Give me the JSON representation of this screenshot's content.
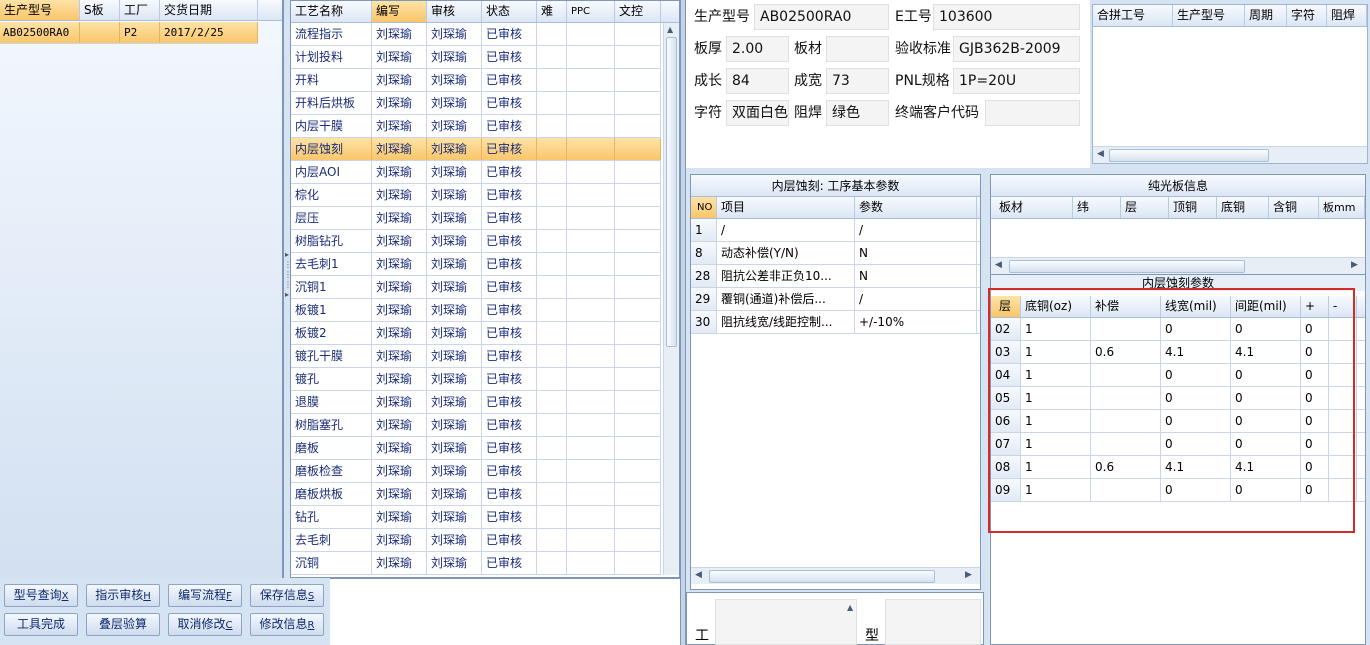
{
  "product_list": {
    "columns": [
      "生产型号",
      "S板",
      "工厂",
      "交货日期"
    ],
    "rows": [
      [
        "AB02500RA0",
        "",
        "P2",
        "2017/2/25"
      ]
    ]
  },
  "process_list": {
    "columns": [
      "工艺名称",
      "编写",
      "审核",
      "状态",
      "难",
      "PPC",
      "文控"
    ],
    "rows": [
      [
        "流程指示",
        "刘琛瑜",
        "刘琛瑜",
        "已审核"
      ],
      [
        "计划投料",
        "刘琛瑜",
        "刘琛瑜",
        "已审核"
      ],
      [
        "开料",
        "刘琛瑜",
        "刘琛瑜",
        "已审核"
      ],
      [
        "开料后烘板",
        "刘琛瑜",
        "刘琛瑜",
        "已审核"
      ],
      [
        "内层干膜",
        "刘琛瑜",
        "刘琛瑜",
        "已审核"
      ],
      [
        "内层蚀刻",
        "刘琛瑜",
        "刘琛瑜",
        "已审核"
      ],
      [
        "内层AOI",
        "刘琛瑜",
        "刘琛瑜",
        "已审核"
      ],
      [
        "棕化",
        "刘琛瑜",
        "刘琛瑜",
        "已审核"
      ],
      [
        "层压",
        "刘琛瑜",
        "刘琛瑜",
        "已审核"
      ],
      [
        "树脂钻孔",
        "刘琛瑜",
        "刘琛瑜",
        "已审核"
      ],
      [
        "去毛刺1",
        "刘琛瑜",
        "刘琛瑜",
        "已审核"
      ],
      [
        "沉铜1",
        "刘琛瑜",
        "刘琛瑜",
        "已审核"
      ],
      [
        "板镀1",
        "刘琛瑜",
        "刘琛瑜",
        "已审核"
      ],
      [
        "板镀2",
        "刘琛瑜",
        "刘琛瑜",
        "已审核"
      ],
      [
        "镀孔干膜",
        "刘琛瑜",
        "刘琛瑜",
        "已审核"
      ],
      [
        "镀孔",
        "刘琛瑜",
        "刘琛瑜",
        "已审核"
      ],
      [
        "退膜",
        "刘琛瑜",
        "刘琛瑜",
        "已审核"
      ],
      [
        "树脂塞孔",
        "刘琛瑜",
        "刘琛瑜",
        "已审核"
      ],
      [
        "磨板",
        "刘琛瑜",
        "刘琛瑜",
        "已审核"
      ],
      [
        "磨板检查",
        "刘琛瑜",
        "刘琛瑜",
        "已审核"
      ],
      [
        "磨板烘板",
        "刘琛瑜",
        "刘琛瑜",
        "已审核"
      ],
      [
        "钻孔",
        "刘琛瑜",
        "刘琛瑜",
        "已审核"
      ],
      [
        "去毛刺",
        "刘琛瑜",
        "刘琛瑜",
        "已审核"
      ],
      [
        "沉铜",
        "刘琛瑜",
        "刘琛瑜",
        "已审核"
      ]
    ],
    "selected_index": 5
  },
  "buttons": {
    "row1": [
      {
        "label": "型号查询",
        "key": "X"
      },
      {
        "label": "指示审核",
        "key": "H"
      },
      {
        "label": "编写流程",
        "key": "F"
      },
      {
        "label": "保存信息",
        "key": "S"
      }
    ],
    "row2": [
      {
        "label": "工具完成",
        "key": ""
      },
      {
        "label": "叠层验算",
        "key": ""
      },
      {
        "label": "取消修改",
        "key": "C"
      },
      {
        "label": "修改信息",
        "key": "R"
      }
    ]
  },
  "info": {
    "model_label": "生产型号",
    "model": "AB02500RA0",
    "e_label": "E工号",
    "e_no": "103600",
    "thick_label": "板厚",
    "thick": "2.00",
    "mat_label": "板材",
    "mat": "",
    "std_label": "验收标准",
    "std": "GJB362B-2009",
    "len_label": "成长",
    "len": "84",
    "wid_label": "成宽",
    "wid": "73",
    "pnl_label": "PNL规格",
    "pnl": "1P=20U",
    "char_label": "字符",
    "char": "双面白色",
    "mask_label": "阻焊",
    "mask": "绿色",
    "cust_label": "终端客户代码",
    "cust": ""
  },
  "merge": {
    "columns": [
      "合拼工号",
      "生产型号",
      "周期",
      "字符",
      "阻焊"
    ]
  },
  "params": {
    "title": "内层蚀刻: 工序基本参数",
    "columns": [
      "NO",
      "项目",
      "参数"
    ],
    "rows": [
      [
        "1",
        "/",
        "/"
      ],
      [
        "8",
        "动态补偿(Y/N)",
        "N"
      ],
      [
        "28",
        "阻抗公差非正负10...",
        "N"
      ],
      [
        "29",
        "覆铜(通道)补偿后...",
        "/"
      ],
      [
        "30",
        "阻抗线宽/线距控制...",
        "+/-10%"
      ]
    ]
  },
  "bare_board": {
    "title": "纯光板信息",
    "columns": [
      "板材",
      "纬",
      "层",
      "顶铜",
      "底铜",
      "含铜",
      "板mm"
    ]
  },
  "etch": {
    "title": "内层蚀刻参数",
    "columns": [
      "层",
      "底铜(oz)",
      "补偿",
      "线宽(mil)",
      "间距(mil)",
      "+",
      "-"
    ],
    "rows": [
      [
        "02",
        "1",
        "",
        "0",
        "0",
        "0"
      ],
      [
        "03",
        "1",
        "0.6",
        "4.1",
        "4.1",
        "0"
      ],
      [
        "04",
        "1",
        "",
        "0",
        "0",
        "0"
      ],
      [
        "05",
        "1",
        "",
        "0",
        "0",
        "0"
      ],
      [
        "06",
        "1",
        "",
        "0",
        "0",
        "0"
      ],
      [
        "07",
        "1",
        "",
        "0",
        "0",
        "0"
      ],
      [
        "08",
        "1",
        "0.6",
        "4.1",
        "4.1",
        "0"
      ],
      [
        "09",
        "1",
        "",
        "0",
        "0",
        "0"
      ]
    ]
  },
  "bottom": {
    "gong": "工",
    "xing": "型"
  }
}
